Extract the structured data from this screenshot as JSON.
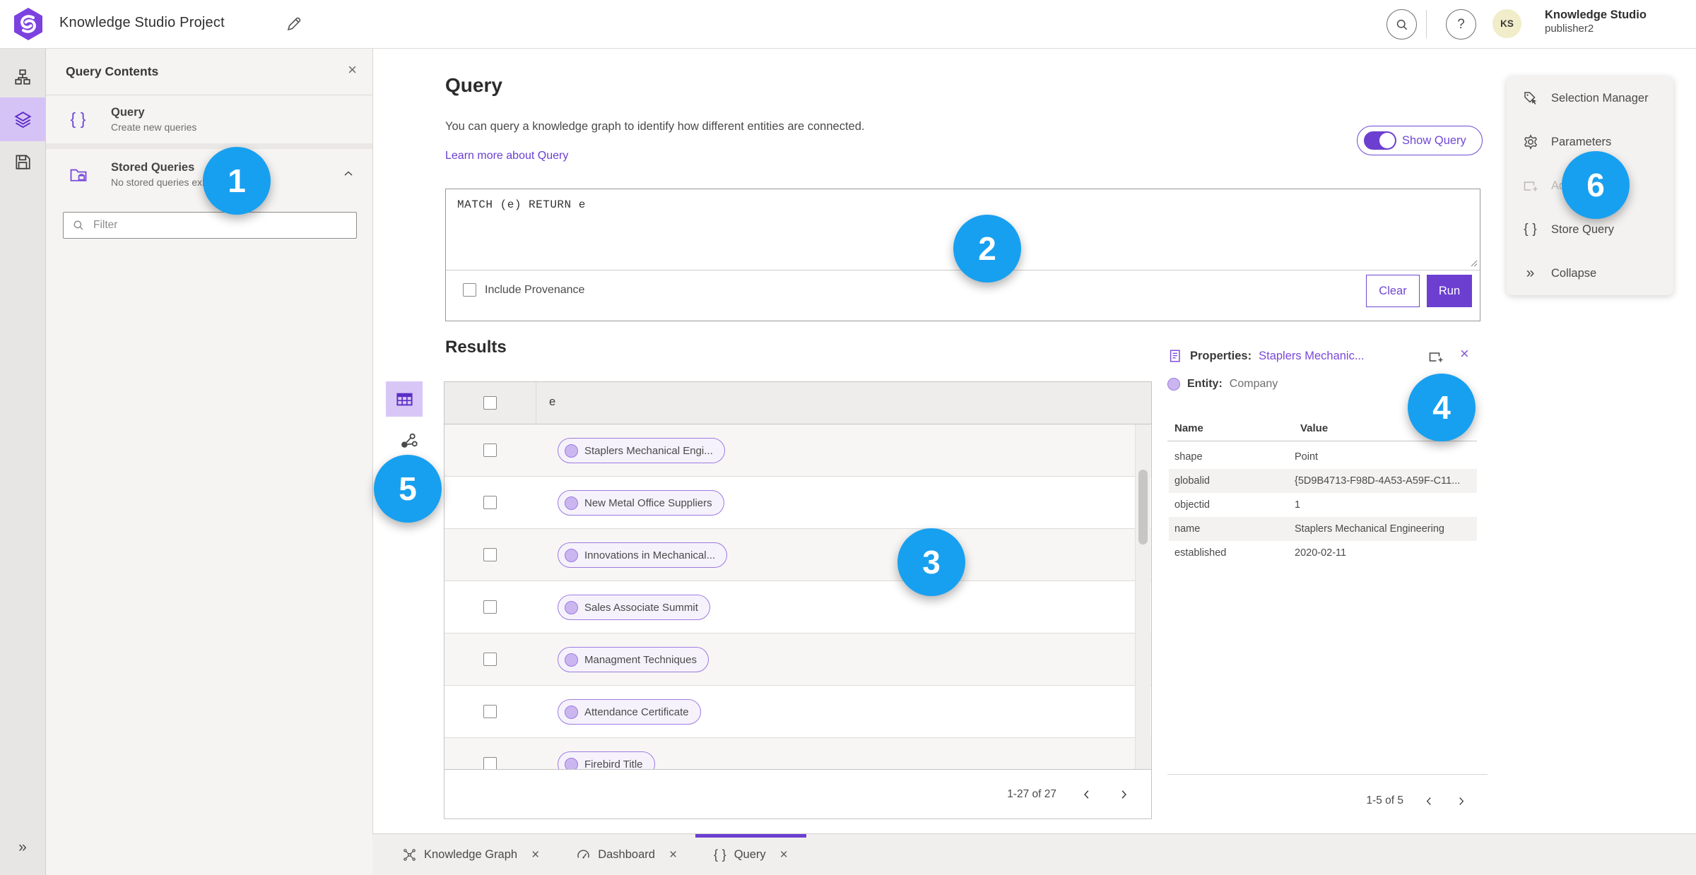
{
  "header": {
    "title": "Knowledge Studio Project",
    "user_name": "Knowledge Studio",
    "user_role": "publisher2",
    "avatar_initials": "KS"
  },
  "left_rail": {
    "icons": [
      "data-model-icon",
      "layers-icon",
      "save-icon",
      "expand-icon"
    ],
    "active_icon": "layers-icon"
  },
  "contents_panel": {
    "title": "Query Contents",
    "items": [
      {
        "label": "Query",
        "sublabel": "Create new queries",
        "icon": "braces-icon"
      },
      {
        "label": "Stored Queries",
        "sublabel": "No stored queries exist",
        "icon": "stored-queries-folder-icon"
      }
    ],
    "filter_placeholder": "Filter"
  },
  "query_section": {
    "title": "Query",
    "description": "You can query a knowledge graph to identify how different entities are connected.",
    "learn_more": "Learn more about Query",
    "show_query_label": "Show Query",
    "show_query_on": true,
    "query_text": "MATCH (e) RETURN e",
    "include_provenance_label": "Include Provenance",
    "include_provenance_checked": false,
    "clear_label": "Clear",
    "run_label": "Run"
  },
  "results": {
    "title": "Results",
    "column_header": "e",
    "rows": [
      "Staplers Mechanical Engi...",
      "New Metal Office Suppliers",
      "Innovations in Mechanical...",
      "Sales Associate Summit",
      "Managment Techniques",
      "Attendance Certificate",
      "Firebird Title"
    ],
    "pagination": "1-27 of 27"
  },
  "properties_panel": {
    "title_label": "Properties:",
    "title_value": "Staplers Mechanic...",
    "entity_label": "Entity:",
    "entity_value": "Company",
    "columns": [
      "Name",
      "Value"
    ],
    "rows": [
      {
        "name": "shape",
        "value": "Point"
      },
      {
        "name": "globalid",
        "value": "{5D9B4713-F98D-4A53-A59F-C11..."
      },
      {
        "name": "objectid",
        "value": "1"
      },
      {
        "name": "name",
        "value": "Staplers Mechanical Engineering"
      },
      {
        "name": "established",
        "value": "2020-02-11"
      }
    ],
    "pagination": "1-5 of 5"
  },
  "actions_menu": {
    "items": [
      {
        "label": "Selection Manager",
        "icon": "selection-manager-icon",
        "disabled": false
      },
      {
        "label": "Parameters",
        "icon": "gear-icon",
        "disabled": false
      },
      {
        "label": "Add To Map",
        "icon": "add-to-map-icon",
        "disabled": true
      },
      {
        "label": "Store Query",
        "icon": "braces-icon",
        "disabled": false
      },
      {
        "label": "Collapse",
        "icon": "collapse-icon",
        "disabled": false
      }
    ]
  },
  "bottom_tabs": [
    {
      "label": "Knowledge Graph",
      "icon": "knowledge-graph-icon",
      "active": false
    },
    {
      "label": "Dashboard",
      "icon": "dashboard-icon",
      "active": false
    },
    {
      "label": "Query",
      "icon": "braces-icon",
      "active": true
    }
  ],
  "annotations": [
    {
      "number": "1"
    },
    {
      "number": "2"
    },
    {
      "number": "3"
    },
    {
      "number": "4"
    },
    {
      "number": "5"
    },
    {
      "number": "6"
    }
  ],
  "colors": {
    "accent_purple": "#6C3FD0",
    "link_purple": "#6A3FD3",
    "pill_border": "#9D7CE0",
    "pill_bg": "#F6F2FC",
    "pill_dot": "#CBB6F0",
    "rail_active_bg": "#D6C3F6",
    "annotation_blue": "#18A0F0",
    "avatar_bg": "#F1ECC9"
  }
}
